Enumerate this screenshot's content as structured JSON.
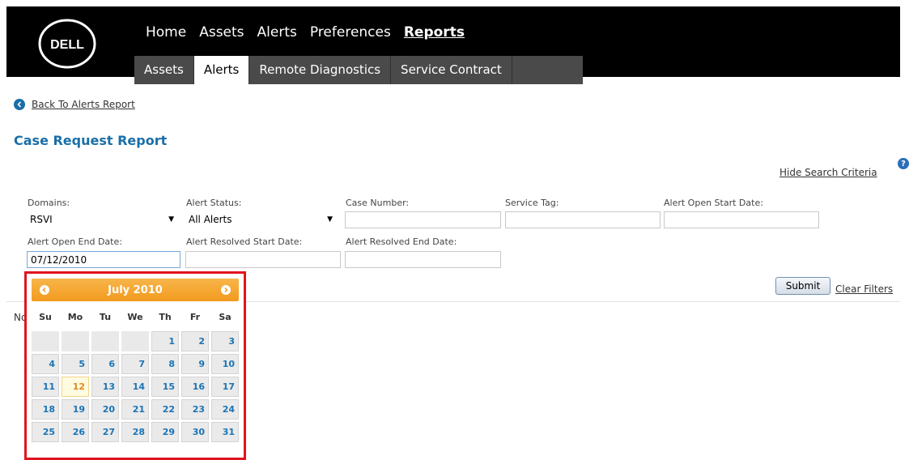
{
  "header": {
    "logo_text": "DELL",
    "main_nav": [
      "Home",
      "Assets",
      "Alerts",
      "Preferences",
      "Reports"
    ],
    "active_main_nav": "Reports",
    "sub_tabs": [
      "Assets",
      "Alerts",
      "Remote Diagnostics",
      "Service Contract"
    ],
    "active_sub_tab": "Alerts"
  },
  "back_link": "Back To Alerts Report",
  "page_title": "Case Request Report",
  "hide_search_criteria": "Hide Search Criteria",
  "help_icon": "?",
  "filters": {
    "domains": {
      "label": "Domains:",
      "value": "RSVI"
    },
    "alert_status": {
      "label": "Alert Status:",
      "value": "All Alerts"
    },
    "case_number": {
      "label": "Case Number:",
      "value": ""
    },
    "service_tag": {
      "label": "Service Tag:",
      "value": ""
    },
    "alert_open_start_date": {
      "label": "Alert Open Start Date:",
      "value": ""
    },
    "alert_open_end_date": {
      "label": "Alert Open End Date:",
      "value": "07/12/2010"
    },
    "alert_resolved_start_date": {
      "label": "Alert Resolved Start Date:",
      "value": ""
    },
    "alert_resolved_end_date": {
      "label": "Alert Resolved End Date:",
      "value": ""
    }
  },
  "buttons": {
    "submit": "Submit",
    "clear_filters": "Clear Filters"
  },
  "results_text": "No",
  "calendar": {
    "title": "July 2010",
    "weekdays": [
      "Su",
      "Mo",
      "Tu",
      "We",
      "Th",
      "Fr",
      "Sa"
    ],
    "leading_blank_days": 4,
    "days": [
      "1",
      "2",
      "3",
      "4",
      "5",
      "6",
      "7",
      "8",
      "9",
      "10",
      "11",
      "12",
      "13",
      "14",
      "15",
      "16",
      "17",
      "18",
      "19",
      "20",
      "21",
      "22",
      "23",
      "24",
      "25",
      "26",
      "27",
      "28",
      "29",
      "30",
      "31"
    ],
    "selected_day": "12"
  },
  "colors": {
    "title_blue": "#1a6fa8",
    "calendar_header": "#f39a1f",
    "highlight_border": "#e0141d",
    "day_text": "#1b74b5",
    "today_text": "#e08a1e"
  }
}
